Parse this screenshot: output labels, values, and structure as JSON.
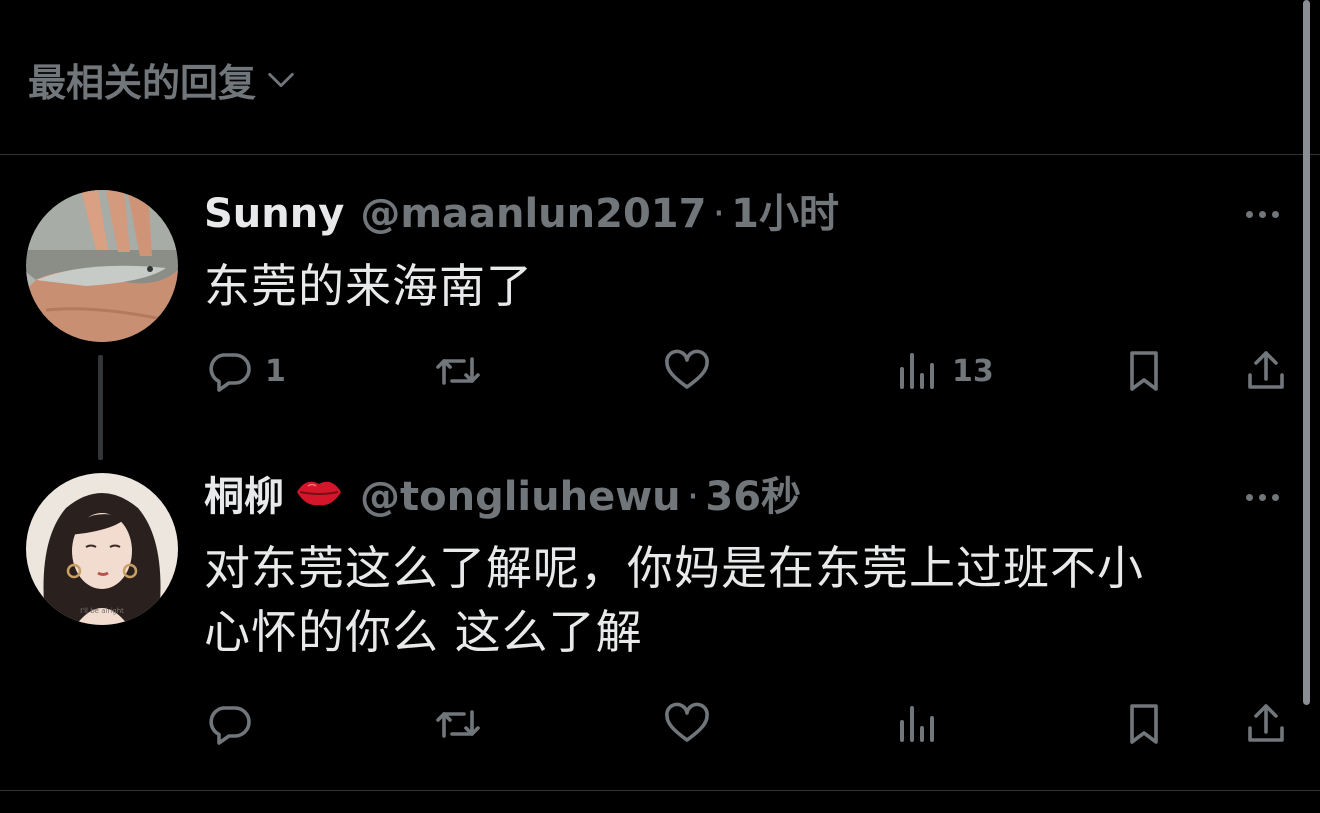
{
  "sort": {
    "label": "最相关的回复"
  },
  "tweets": [
    {
      "display_name": "Sunny",
      "handle": "@maanlun2017",
      "separator": "·",
      "time": "1小时",
      "text_lines": [
        "东莞的来海南了"
      ],
      "actions": {
        "replies": "1",
        "retweets": "",
        "likes": "",
        "views": "13"
      }
    },
    {
      "display_name": "桐柳",
      "name_emoji": "lips-kiss-icon",
      "handle": "@tongliuhewu",
      "separator": "·",
      "time": "36秒",
      "text_lines": [
        "对东莞这么了解呢，你妈是在东莞上过班不小",
        "心怀的你么 这么了解"
      ],
      "actions": {
        "replies": "",
        "retweets": "",
        "likes": "",
        "views": ""
      }
    }
  ],
  "icons": [
    "chevron-down-icon",
    "more-icon",
    "reply-icon",
    "retweet-icon",
    "like-icon",
    "views-icon",
    "bookmark-icon",
    "share-icon"
  ],
  "colors": {
    "background": "#000000",
    "primary_text": "#e7e9ea",
    "secondary_text": "#71767b",
    "divider": "#2f3336"
  }
}
